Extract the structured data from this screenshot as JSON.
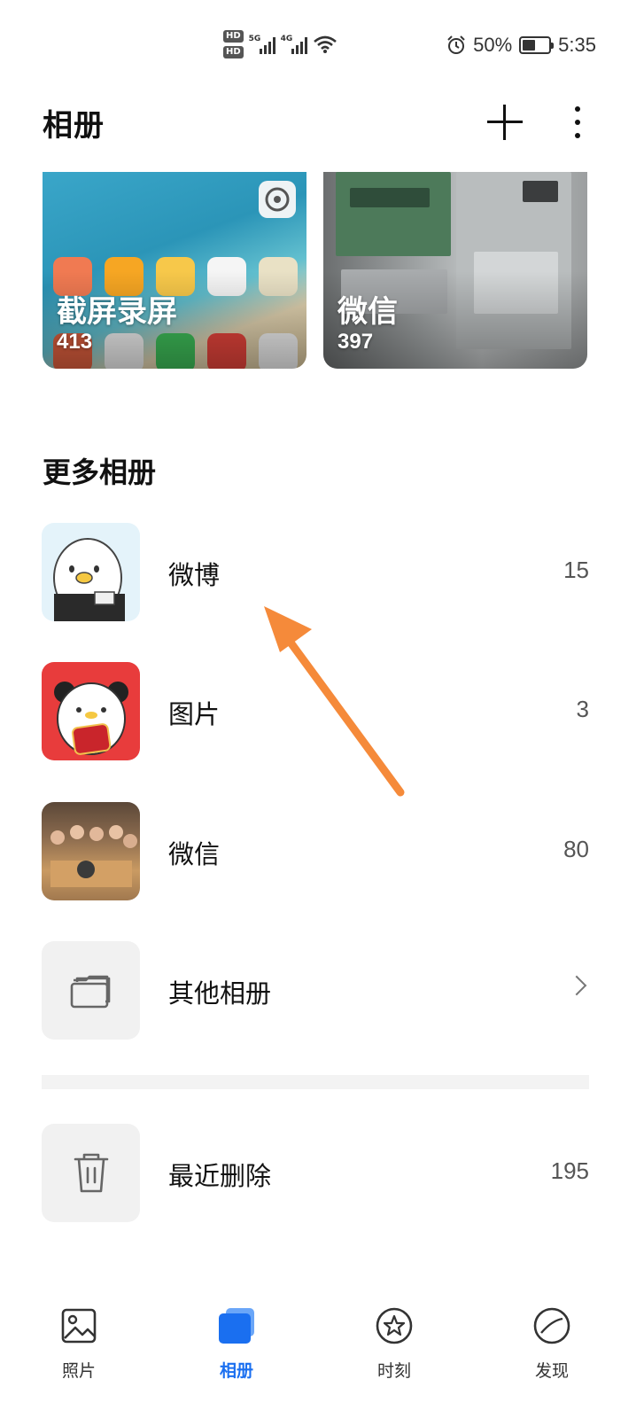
{
  "status_bar": {
    "hd_top": "HD",
    "hd_bottom": "HD",
    "network_1": "5G",
    "network_2": "4G",
    "battery_percent": "50%",
    "battery_level": 0.5,
    "time": "5:35"
  },
  "header": {
    "title": "相册"
  },
  "featured_albums": [
    {
      "name": "截屏录屏",
      "count": "413"
    },
    {
      "name": "微信",
      "count": "397"
    }
  ],
  "more_section": {
    "title": "更多相册"
  },
  "albums": [
    {
      "name": "微博",
      "count": "15"
    },
    {
      "name": "图片",
      "count": "3"
    },
    {
      "name": "微信",
      "count": "80"
    },
    {
      "name": "其他相册"
    }
  ],
  "recently_deleted": {
    "name": "最近删除",
    "count": "195"
  },
  "bottom_nav": [
    {
      "label": "照片",
      "icon": "photo-icon",
      "active": false
    },
    {
      "label": "相册",
      "icon": "album-icon",
      "active": true
    },
    {
      "label": "时刻",
      "icon": "star-moments-icon",
      "active": false
    },
    {
      "label": "发现",
      "icon": "discover-icon",
      "active": false
    }
  ],
  "colors": {
    "accent": "#1a6ff0",
    "annotation_arrow": "#f58a3a"
  }
}
